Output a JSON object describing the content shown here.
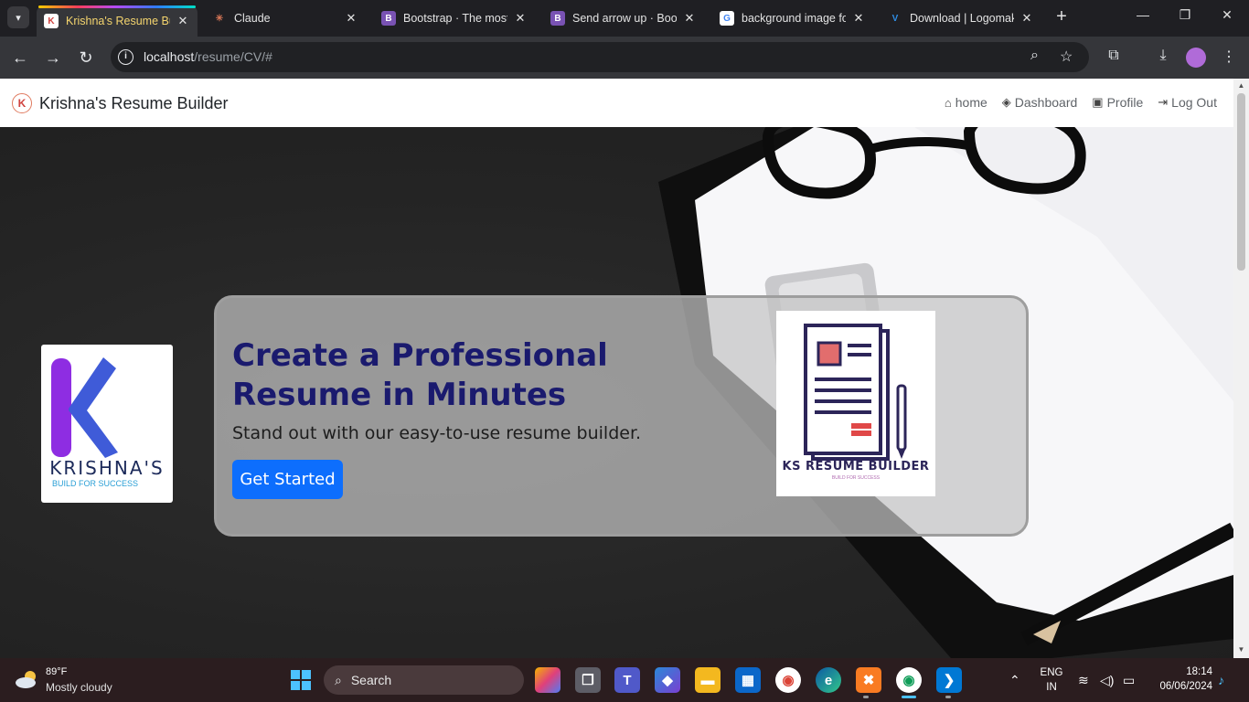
{
  "browser": {
    "tabs": [
      {
        "title": "Krishna's Resume Buil",
        "favicon": "K",
        "favicon_color": "#ffffff",
        "favicon_fg": "#d0433f",
        "active": true
      },
      {
        "title": "Claude",
        "favicon": "✳",
        "favicon_color": "transparent",
        "favicon_fg": "#d97757",
        "active": false
      },
      {
        "title": "Bootstrap · The most",
        "favicon": "B",
        "favicon_color": "#7952b3",
        "favicon_fg": "#ffffff",
        "active": false
      },
      {
        "title": "Send arrow up · Boot",
        "favicon": "B",
        "favicon_color": "#7952b3",
        "favicon_fg": "#ffffff",
        "active": false
      },
      {
        "title": "background image fo",
        "favicon": "G",
        "favicon_color": "#ffffff",
        "favicon_fg": "#4285f4",
        "active": false
      },
      {
        "title": "Download | Logomak",
        "favicon": "V",
        "favicon_color": "transparent",
        "favicon_fg": "#2f8de4",
        "active": false
      }
    ],
    "url_host": "localhost",
    "url_path": "/resume/CV/#"
  },
  "site": {
    "brand_logo": "K",
    "brand_name": "Krishna's Resume Builder",
    "nav": [
      {
        "label": "home",
        "icon": "home-icon",
        "glyph": "⌂"
      },
      {
        "label": "Dashboard",
        "icon": "box-icon",
        "glyph": "◈"
      },
      {
        "label": "Profile",
        "icon": "person-badge-icon",
        "glyph": "▣"
      },
      {
        "label": "Log Out",
        "icon": "logout-icon",
        "glyph": "⇥"
      }
    ]
  },
  "hero": {
    "k_logo_word": "KRISHNA'S",
    "k_logo_tag": "BUILD FOR SUCCESS",
    "headline": "Create a Professional Resume in Minutes",
    "subline": "Stand out with our easy-to-use resume builder.",
    "cta_label": "Get Started",
    "ks_logo_name": "KS RESUME BUILDER",
    "ks_logo_tag": "BUILD FOR SUCCESS"
  },
  "taskbar": {
    "weather_temp": "89°F",
    "weather_desc": "Mostly cloudy",
    "search_label": "Search",
    "lang": "ENG",
    "region": "IN",
    "time": "18:14",
    "date": "06/06/2024"
  },
  "colors": {
    "accent": "#0d6efd",
    "headline": "#1a1a6e"
  }
}
